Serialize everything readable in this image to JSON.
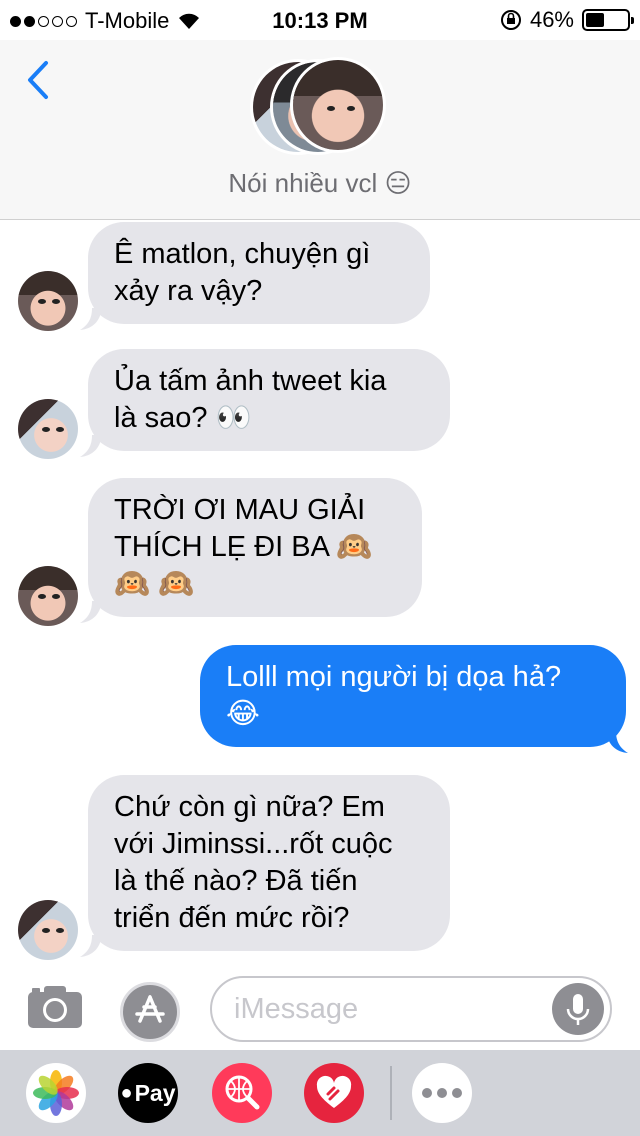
{
  "status_bar": {
    "carrier": "T-Mobile",
    "time": "10:13 PM",
    "battery": "46%",
    "battery_level": 0.46
  },
  "header": {
    "conversation_name": "Nói nhiều vcl 😑"
  },
  "messages": [
    {
      "direction": "in",
      "lines": [
        "Ê matlon, chuyện gì",
        "xảy ra vậy?"
      ]
    },
    {
      "direction": "in",
      "lines": [
        "Ủa tấm ảnh tweet kia",
        "là sao? 👀"
      ]
    },
    {
      "direction": "in",
      "lines": [
        "TRỜI ƠI MAU GIẢI",
        "THÍCH LẸ ĐI BA 🙉",
        "🙉 🙉"
      ]
    },
    {
      "direction": "out",
      "lines": [
        "Lolll mọi người bị dọa hả?",
        "😂"
      ]
    },
    {
      "direction": "in",
      "lines": [
        "Chứ còn gì nữa? Em",
        "với Jiminssi...rốt cuộc",
        "là thế nào? Đã tiến",
        "triển đến mức rồi?"
      ]
    }
  ],
  "compose": {
    "placeholder": "iMessage"
  },
  "drawer": {
    "pay_label": "Pay"
  }
}
